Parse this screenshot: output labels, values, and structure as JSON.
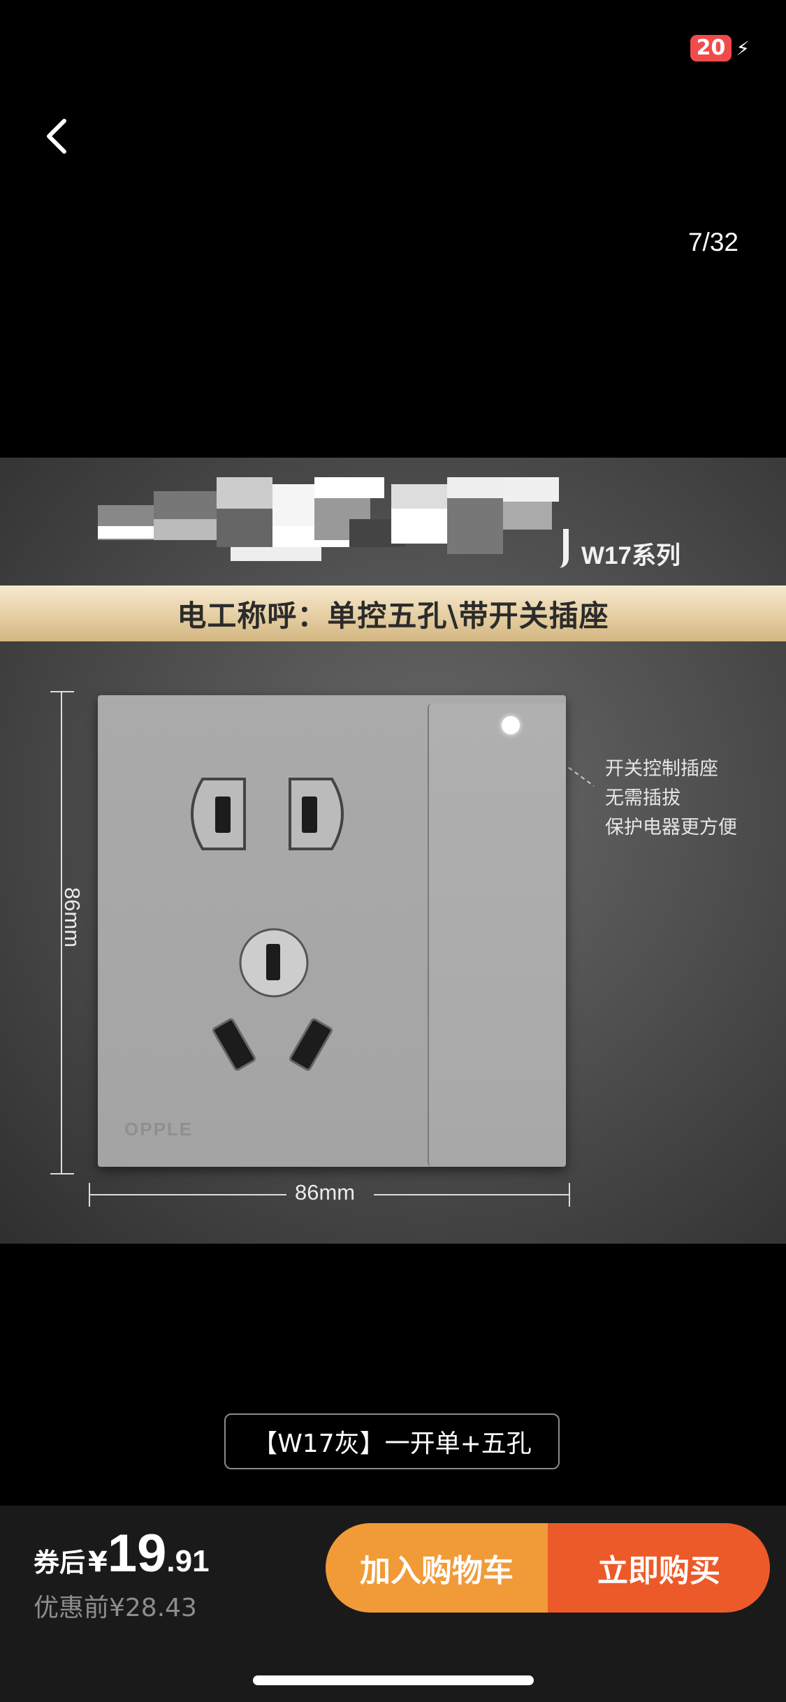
{
  "status_bar": {
    "battery": "20"
  },
  "viewer": {
    "counter": "7/32"
  },
  "product_image": {
    "series": "W17系列",
    "banner": "电工称呼：单控五孔\\带开关插座",
    "callout_lines": [
      "开关控制插座",
      "无需插拔",
      "保护电器更方便"
    ],
    "brand": "OPPLE",
    "dim_width": "86mm",
    "dim_height": "86mm"
  },
  "variant": {
    "selected": "【W17灰】一开单+五孔"
  },
  "purchase": {
    "coupon_label": "券后",
    "currency": "¥",
    "price_int": "19",
    "price_dec": ".91",
    "original_price": "优惠前¥28.43",
    "add_to_cart": "加入购物车",
    "buy_now": "立即购买"
  },
  "colors": {
    "cart": "#f19a38",
    "buy": "#ec5a29",
    "battery_low": "#f24b4b",
    "banner_gold": "#e5cea2"
  }
}
